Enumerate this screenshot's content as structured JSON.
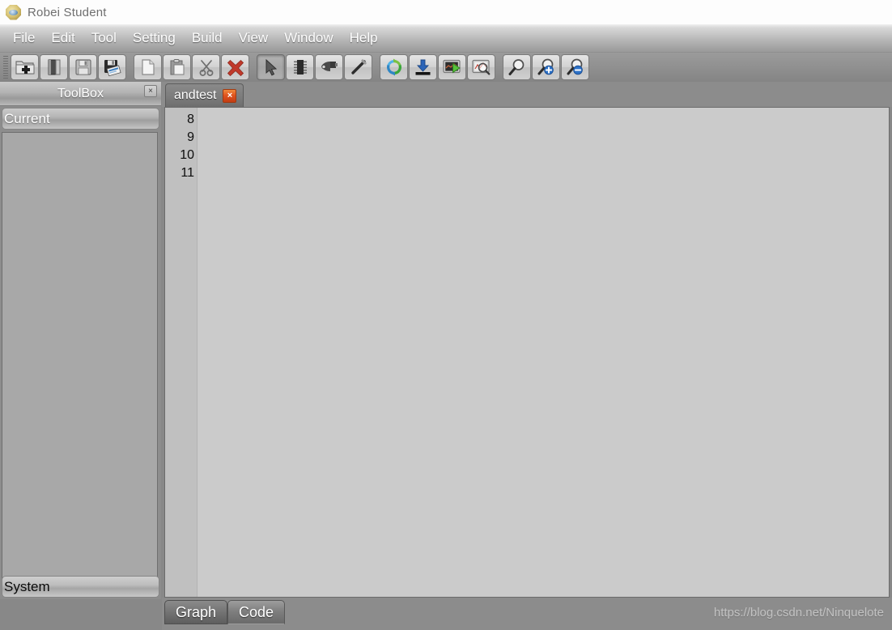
{
  "window": {
    "title": "Robei  Student",
    "logo_icon": "robei-octagon-logo"
  },
  "menubar": {
    "items": [
      {
        "label": "File"
      },
      {
        "label": "Edit"
      },
      {
        "label": "Tool"
      },
      {
        "label": "Setting"
      },
      {
        "label": "Build"
      },
      {
        "label": "View"
      },
      {
        "label": "Window"
      },
      {
        "label": "Help"
      }
    ]
  },
  "toolbar": {
    "groups": [
      {
        "buttons": [
          {
            "name": "new-project-button",
            "icon": "folder-plus-icon",
            "pressed": false
          },
          {
            "name": "open-project-button",
            "icon": "open-folder-icon",
            "pressed": false
          },
          {
            "name": "save-button",
            "icon": "floppy-disk-icon",
            "pressed": false
          },
          {
            "name": "save-as-button",
            "icon": "floppy-disk-page-icon",
            "pressed": false
          }
        ]
      },
      {
        "buttons": [
          {
            "name": "new-file-button",
            "icon": "document-icon",
            "pressed": false
          },
          {
            "name": "paste-button",
            "icon": "clipboard-icon",
            "pressed": false
          },
          {
            "name": "cut-button",
            "icon": "scissors-icon",
            "pressed": false
          },
          {
            "name": "delete-button",
            "icon": "red-x-icon",
            "pressed": false
          }
        ]
      },
      {
        "buttons": [
          {
            "name": "select-tool-button",
            "icon": "cursor-arrow-icon",
            "pressed": true
          },
          {
            "name": "module-tool-button",
            "icon": "chip-icon",
            "pressed": false
          },
          {
            "name": "port-tool-button",
            "icon": "connector-icon",
            "pressed": false
          },
          {
            "name": "wire-tool-button",
            "icon": "pen-line-icon",
            "pressed": false
          }
        ]
      },
      {
        "buttons": [
          {
            "name": "compile-button",
            "icon": "refresh-cycle-icon",
            "pressed": false
          },
          {
            "name": "download-button",
            "icon": "download-arrow-icon",
            "pressed": false
          },
          {
            "name": "simulate-button",
            "icon": "run-play-icon",
            "pressed": false
          },
          {
            "name": "waveform-button",
            "icon": "inspect-magnifier-icon",
            "pressed": false
          }
        ]
      },
      {
        "buttons": [
          {
            "name": "zoom-normal-button",
            "icon": "magnifier-icon",
            "pressed": false
          },
          {
            "name": "zoom-in-button",
            "icon": "magnifier-plus-icon",
            "pressed": false
          },
          {
            "name": "zoom-out-button",
            "icon": "magnifier-minus-icon",
            "pressed": false
          }
        ]
      }
    ]
  },
  "toolbox": {
    "title": "ToolBox",
    "close_label": "×",
    "current_section": "Current",
    "system_section": "System",
    "current_items": [],
    "system_items": []
  },
  "document_tabs": [
    {
      "name": "andtest",
      "close_label": "×",
      "active": true
    }
  ],
  "editor": {
    "lines": [
      {
        "number": "8",
        "text": ""
      },
      {
        "number": "9",
        "text": ""
      },
      {
        "number": "10",
        "text": ""
      },
      {
        "number": "11",
        "text": ""
      }
    ]
  },
  "view_tabs": [
    {
      "label": "Graph",
      "active": false
    },
    {
      "label": "Code",
      "active": true
    }
  ],
  "watermark": "https://blog.csdn.net/Ninquelote",
  "colors": {
    "chrome_gray": "#8c8c8c",
    "editor_bg": "#cbcbcb",
    "accent_orange": "#e0541f",
    "logo_gold": "#d9c577"
  }
}
